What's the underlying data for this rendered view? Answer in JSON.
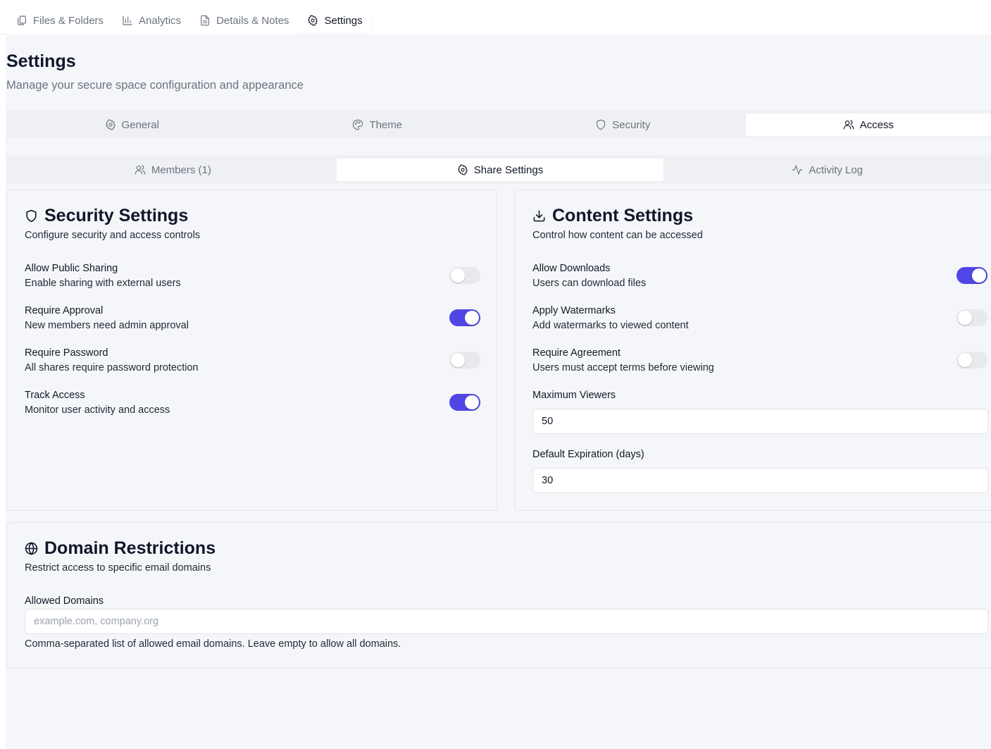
{
  "top_tabs": [
    {
      "label": "Files & Folders",
      "icon": "files-icon",
      "active": false
    },
    {
      "label": "Analytics",
      "icon": "bar-chart-icon",
      "active": false
    },
    {
      "label": "Details & Notes",
      "icon": "document-icon",
      "active": false
    },
    {
      "label": "Settings",
      "icon": "gear-icon",
      "active": true
    }
  ],
  "page": {
    "title": "Settings",
    "subtitle": "Manage your secure space configuration and appearance"
  },
  "settings_tabs": [
    {
      "label": "General",
      "icon": "gear-icon",
      "active": false
    },
    {
      "label": "Theme",
      "icon": "palette-icon",
      "active": false
    },
    {
      "label": "Security",
      "icon": "shield-icon",
      "active": false
    },
    {
      "label": "Access",
      "icon": "users-icon",
      "active": true
    }
  ],
  "access_tabs": [
    {
      "label": "Members (1)",
      "icon": "users-icon",
      "active": false
    },
    {
      "label": "Share Settings",
      "icon": "gear-icon",
      "active": true
    },
    {
      "label": "Activity Log",
      "icon": "activity-icon",
      "active": false
    }
  ],
  "security_card": {
    "title": "Security Settings",
    "description": "Configure security and access controls",
    "settings": [
      {
        "label": "Allow Public Sharing",
        "help": "Enable sharing with external users",
        "enabled": false
      },
      {
        "label": "Require Approval",
        "help": "New members need admin approval",
        "enabled": true
      },
      {
        "label": "Require Password",
        "help": "All shares require password protection",
        "enabled": false
      },
      {
        "label": "Track Access",
        "help": "Monitor user activity and access",
        "enabled": true
      }
    ]
  },
  "content_card": {
    "title": "Content Settings",
    "description": "Control how content can be accessed",
    "settings": [
      {
        "label": "Allow Downloads",
        "help": "Users can download files",
        "enabled": true
      },
      {
        "label": "Apply Watermarks",
        "help": "Add watermarks to viewed content",
        "enabled": false
      },
      {
        "label": "Require Agreement",
        "help": "Users must accept terms before viewing",
        "enabled": false
      }
    ],
    "max_viewers": {
      "label": "Maximum Viewers",
      "value": "50"
    },
    "default_expiration": {
      "label": "Default Expiration (days)",
      "value": "30"
    }
  },
  "domain_card": {
    "title": "Domain Restrictions",
    "description": "Restrict access to specific email domains",
    "allowed_domains": {
      "label": "Allowed Domains",
      "value": "",
      "placeholder": "example.com, company.org",
      "help": "Comma-separated list of allowed email domains. Leave empty to allow all domains."
    }
  },
  "colors": {
    "accent": "#4f46e5",
    "toggle_off": "#e8e9ec",
    "background": "#f5f6f9"
  }
}
